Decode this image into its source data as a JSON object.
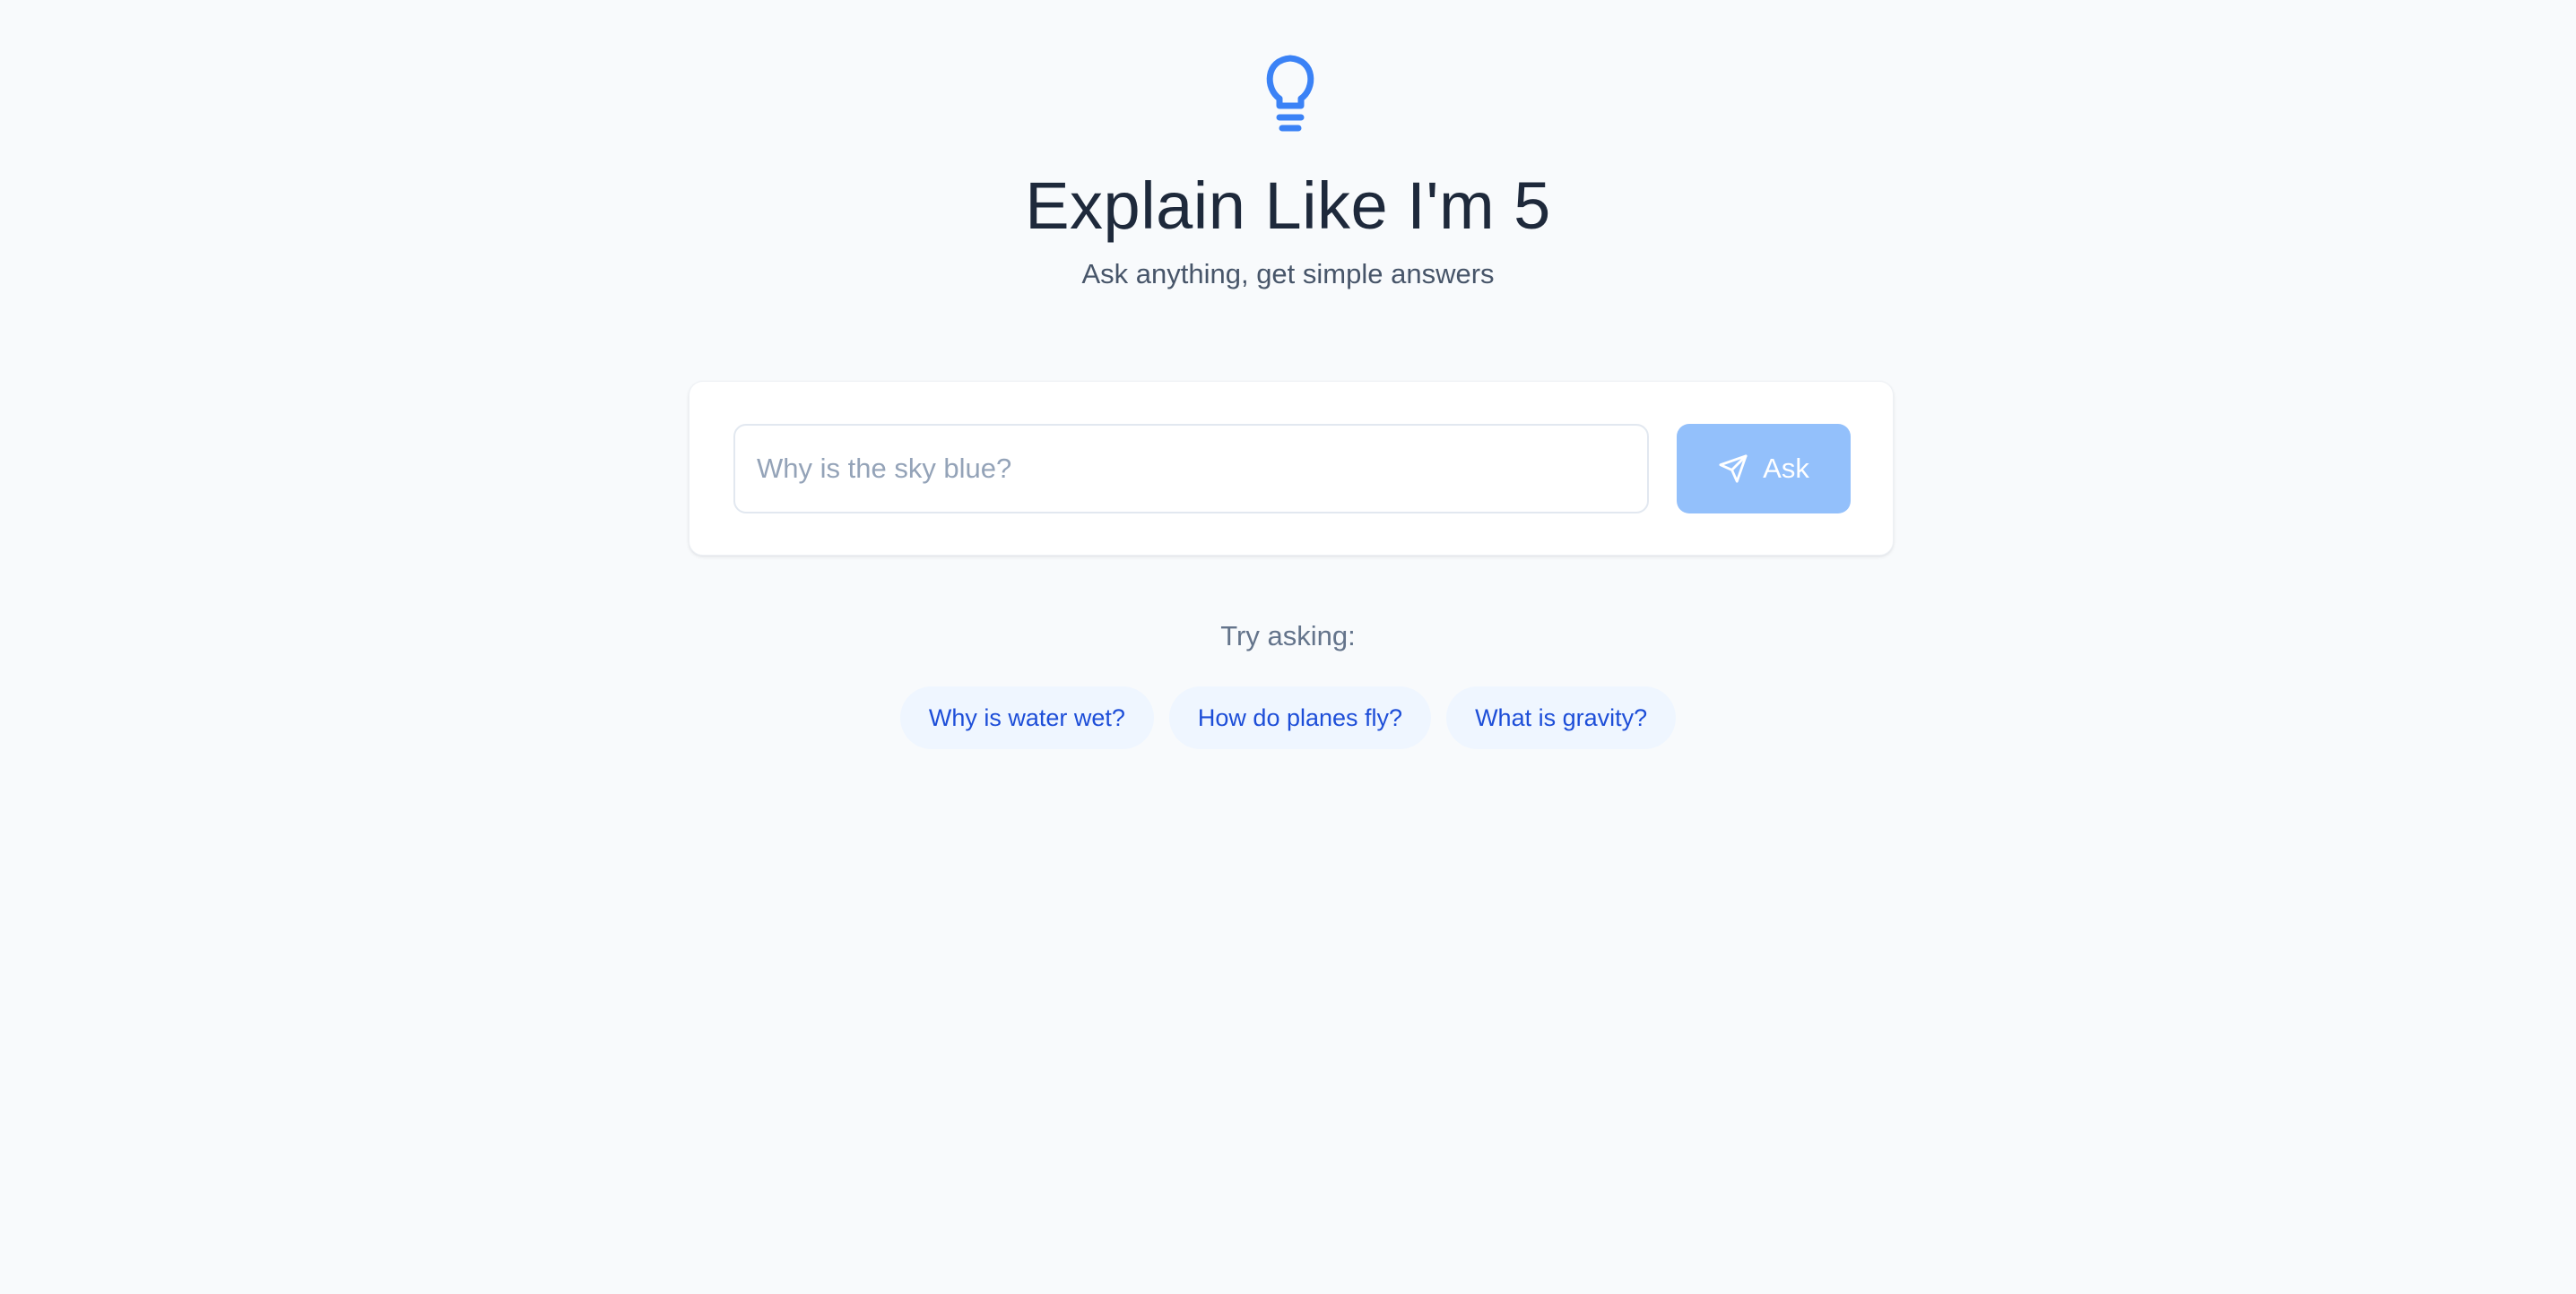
{
  "app": {
    "icon": "lightbulb-icon",
    "title": "Explain Like I'm 5",
    "subtitle": "Ask anything, get simple answers"
  },
  "search": {
    "value": "",
    "placeholder": "Why is the sky blue?",
    "button_label": "Ask",
    "button_icon": "send-icon"
  },
  "suggestions": {
    "label": "Try asking:",
    "items": [
      "Why is water wet?",
      "How do planes fly?",
      "What is gravity?"
    ]
  },
  "colors": {
    "accent": "#3b82f6",
    "button_disabled": "#93c0fb",
    "chip_background": "#eff6ff",
    "chip_text": "#1d4ed8",
    "page_background": "#f8fafc"
  }
}
